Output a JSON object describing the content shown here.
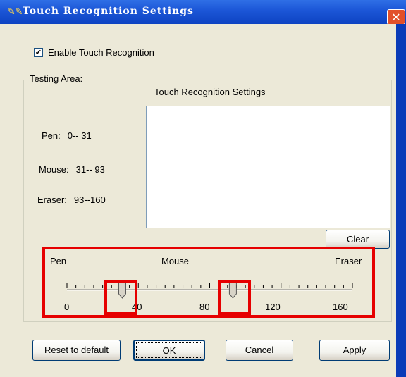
{
  "window": {
    "title": "Touch Recognition Settings",
    "icon": "tools-icon",
    "close_glyph": "✕"
  },
  "enable": {
    "label": "Enable Touch Recognition",
    "checked": true,
    "check_glyph": "✔"
  },
  "testing_area": {
    "group_label": "Testing Area:",
    "title": "Touch Recognition Settings",
    "ranges": [
      {
        "name": "Pen:",
        "value": "0-- 31"
      },
      {
        "name": "Mouse:",
        "value": "31-- 93"
      },
      {
        "name": "Eraser:",
        "value": "93--160"
      }
    ],
    "clear_label": "Clear"
  },
  "slider": {
    "zone_labels": {
      "pen": "Pen",
      "mouse": "Mouse",
      "eraser": "Eraser"
    },
    "min": 0,
    "max": 160,
    "tick_labels": [
      "0",
      "40",
      "80",
      "120",
      "160"
    ],
    "thumb_values": [
      31,
      93
    ]
  },
  "buttons": {
    "reset": "Reset to default",
    "ok": "OK",
    "cancel": "Cancel",
    "apply": "Apply"
  },
  "colors": {
    "titlebar": "#1b55d6",
    "dialog_bg": "#ece9d8",
    "highlight": "#e60000"
  }
}
